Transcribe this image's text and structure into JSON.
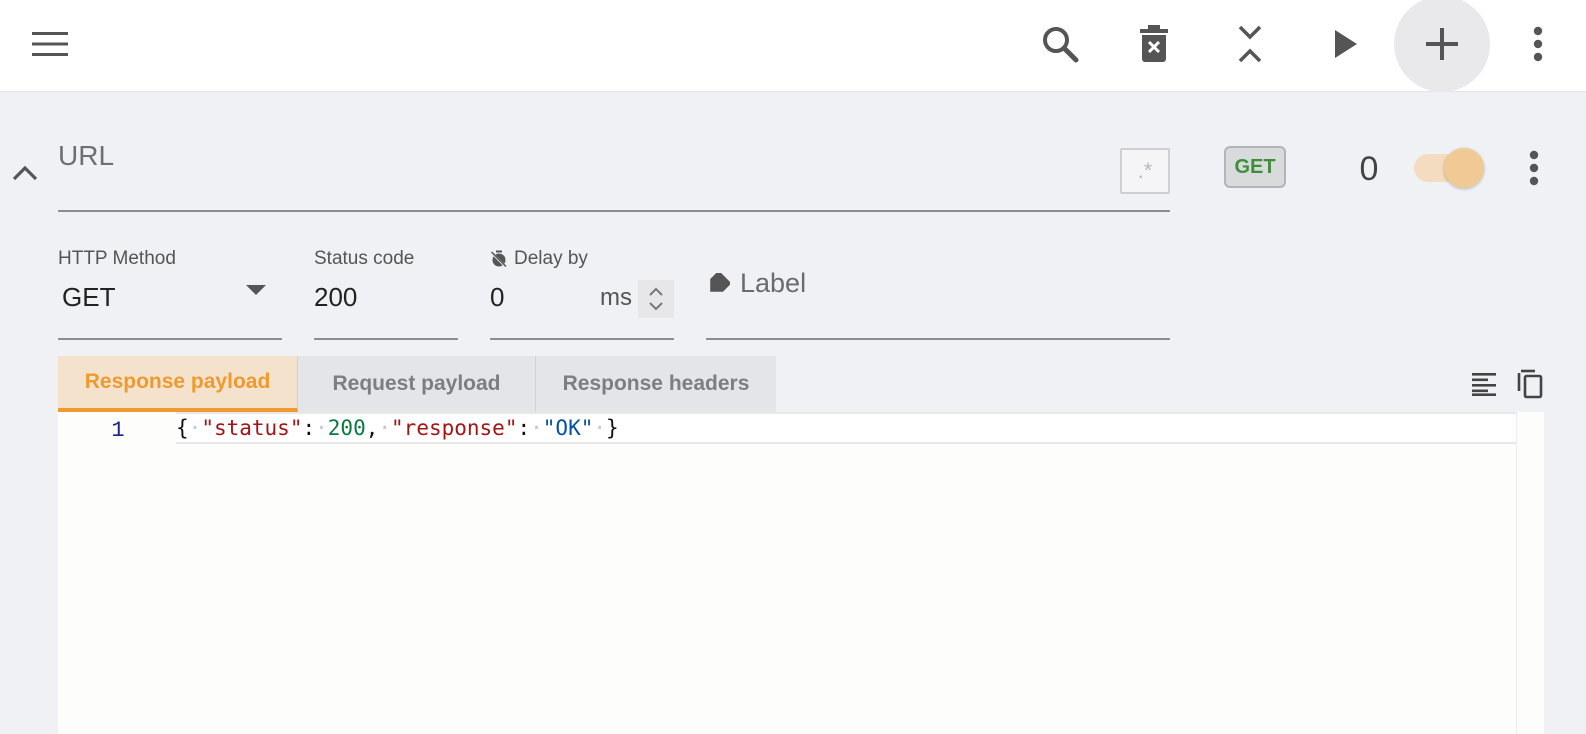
{
  "toolbar": {
    "menu_icon": "hamburger-menu-icon",
    "search_icon": "search-icon",
    "clear_icon": "delete-all-icon",
    "collapse_icon": "collapse-all-icon",
    "play_icon": "play-icon",
    "add_icon": "add-icon",
    "more_icon": "more-vert-icon"
  },
  "rule": {
    "url_placeholder": "URL",
    "regex_symbol": ".*",
    "method_badge": "GET",
    "hit_count": "0",
    "enabled": true
  },
  "form": {
    "http_method_label": "HTTP Method",
    "http_method_value": "GET",
    "status_code_label": "Status code",
    "status_code_value": "200",
    "delay_label": "Delay by",
    "delay_value": "0",
    "delay_unit": "ms",
    "label_placeholder": "Label"
  },
  "tabs": [
    {
      "label": "Response payload",
      "active": true
    },
    {
      "label": "Request payload",
      "active": false
    },
    {
      "label": "Response headers",
      "active": false
    }
  ],
  "editor": {
    "line_number": "1"
  },
  "colors": {
    "accent": "#ef9a2e",
    "method_get": "#3f8f3a",
    "background": "#f0f1f5"
  }
}
